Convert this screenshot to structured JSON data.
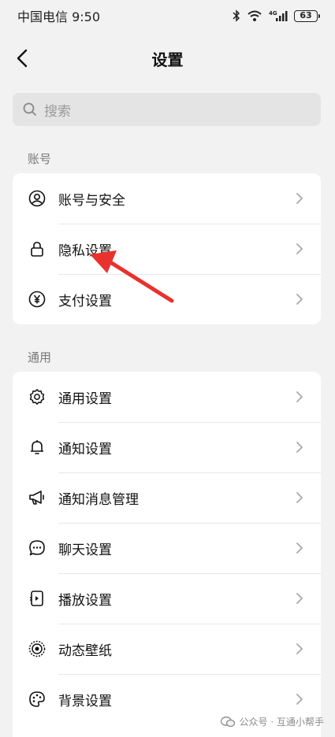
{
  "status_bar": {
    "carrier_time": "中国电信 9:50",
    "battery": "63",
    "network": "4G"
  },
  "nav": {
    "title": "设置"
  },
  "search": {
    "placeholder": "搜索"
  },
  "sections": {
    "account": {
      "label": "账号",
      "items": [
        {
          "label": "账号与安全",
          "icon": "user-circle-icon"
        },
        {
          "label": "隐私设置",
          "icon": "lock-icon"
        },
        {
          "label": "支付设置",
          "icon": "yen-icon"
        }
      ]
    },
    "general": {
      "label": "通用",
      "items": [
        {
          "label": "通用设置",
          "icon": "gear-icon"
        },
        {
          "label": "通知设置",
          "icon": "bell-icon"
        },
        {
          "label": "通知消息管理",
          "icon": "megaphone-icon"
        },
        {
          "label": "聊天设置",
          "icon": "chat-bubble-icon"
        },
        {
          "label": "播放设置",
          "icon": "play-device-icon"
        },
        {
          "label": "动态壁纸",
          "icon": "dynamic-wallpaper-icon"
        },
        {
          "label": "背景设置",
          "icon": "palette-icon"
        }
      ]
    }
  },
  "annotation": {
    "color": "#e8322e"
  },
  "watermark": {
    "text": "公众号 · 互通小帮手"
  }
}
